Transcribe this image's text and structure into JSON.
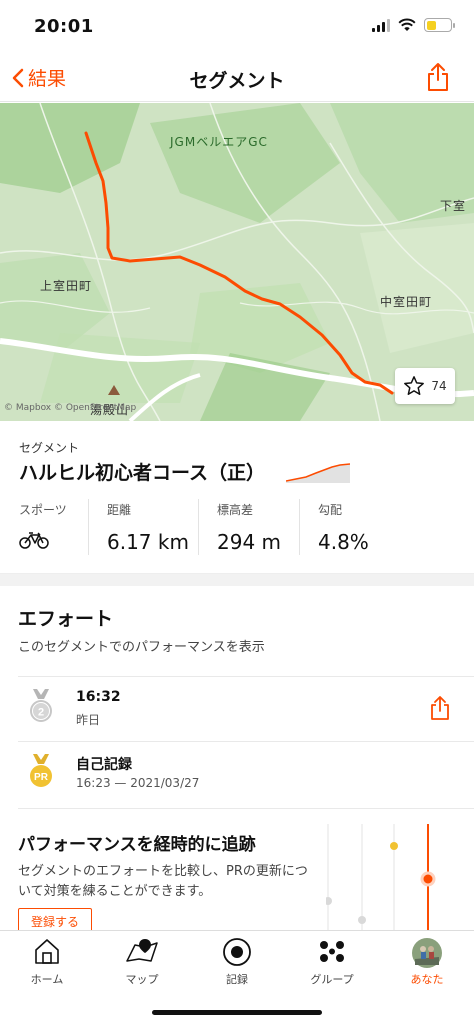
{
  "status": {
    "time": "20:01"
  },
  "nav": {
    "back_label": "結果",
    "title": "セグメント"
  },
  "map": {
    "labels": {
      "golf": "JGMベルエアGC",
      "kami": "上室田町",
      "naka": "中室田町",
      "shimo": "下室",
      "yudono": "湯殿山"
    },
    "star_count": "74",
    "attribution": "© Mapbox © OpenStreetMap"
  },
  "segment": {
    "type_label": "セグメント",
    "name": "ハルヒル初心者コース（正）",
    "stats": [
      {
        "label": "スポーツ",
        "value": ""
      },
      {
        "label": "距離",
        "value": "6.17 km"
      },
      {
        "label": "標高差",
        "value": "294 m"
      },
      {
        "label": "勾配",
        "value": "4.8%"
      }
    ]
  },
  "efforts": {
    "title": "エフォート",
    "subtitle": "このセグメントでのパフォーマンスを表示",
    "items": [
      {
        "rank": "2",
        "time": "16:32",
        "date": "昨日"
      },
      {
        "badge": "PR",
        "title": "自己記録",
        "detail": "16:23 — 2021/03/27"
      }
    ]
  },
  "promo": {
    "title": "パフォーマンスを経時的に追跡",
    "text": "セグメントのエフォートを比較し、PRの更新について対策を練ることができます。",
    "button": "登録する"
  },
  "tabs": [
    {
      "label": "ホーム",
      "icon": "home-icon"
    },
    {
      "label": "マップ",
      "icon": "map-icon"
    },
    {
      "label": "記録",
      "icon": "record-icon"
    },
    {
      "label": "グループ",
      "icon": "groups-icon"
    },
    {
      "label": "あなた",
      "icon": "avatar-icon",
      "active": true
    }
  ],
  "colors": {
    "accent": "#fc4c02",
    "route": "#fc4c02",
    "map_base": "#cfe3c3"
  }
}
